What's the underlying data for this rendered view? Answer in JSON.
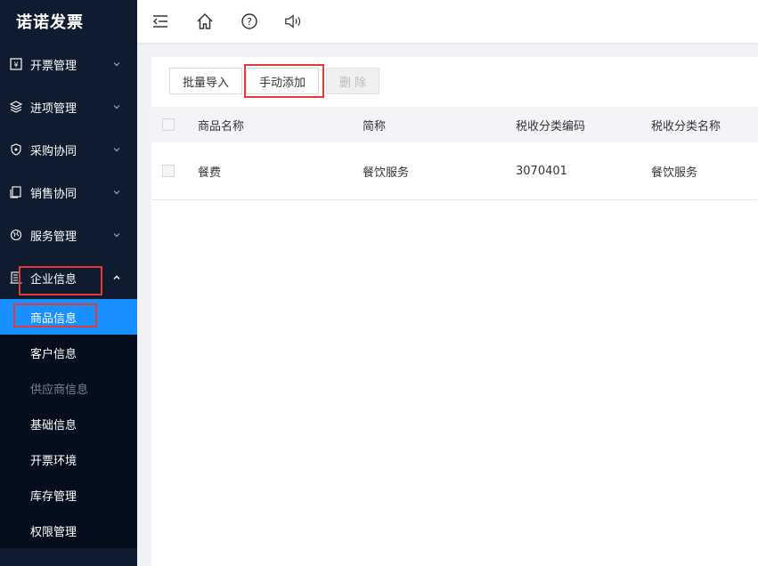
{
  "app": {
    "logo": "诺诺发票"
  },
  "sidebar": {
    "groups": [
      {
        "label": "开票管理",
        "icon": "invoice-icon"
      },
      {
        "label": "进项管理",
        "icon": "layers-icon"
      },
      {
        "label": "采购协同",
        "icon": "shield-icon"
      },
      {
        "label": "销售协同",
        "icon": "copy-icon"
      },
      {
        "label": "服务管理",
        "icon": "globe-icon"
      },
      {
        "label": "企业信息",
        "icon": "building-icon",
        "expanded": true
      }
    ],
    "sub_items": [
      {
        "label": "商品信息",
        "active": true
      },
      {
        "label": "客户信息"
      },
      {
        "label": "供应商信息",
        "disabled": true
      },
      {
        "label": "基础信息"
      },
      {
        "label": "开票环境"
      },
      {
        "label": "库存管理"
      },
      {
        "label": "权限管理"
      }
    ]
  },
  "toolbar": {
    "batch_import": "批量导入",
    "manual_add": "手动添加",
    "delete": "删 除"
  },
  "table": {
    "headers": [
      "商品名称",
      "简称",
      "税收分类编码",
      "税收分类名称"
    ],
    "rows": [
      [
        "餐费",
        "餐饮服务",
        "3070401",
        "餐饮服务"
      ]
    ]
  },
  "colors": {
    "sidebar_bg": "#0f1b2e",
    "active": "#1890ff",
    "highlight": "#e53935"
  }
}
